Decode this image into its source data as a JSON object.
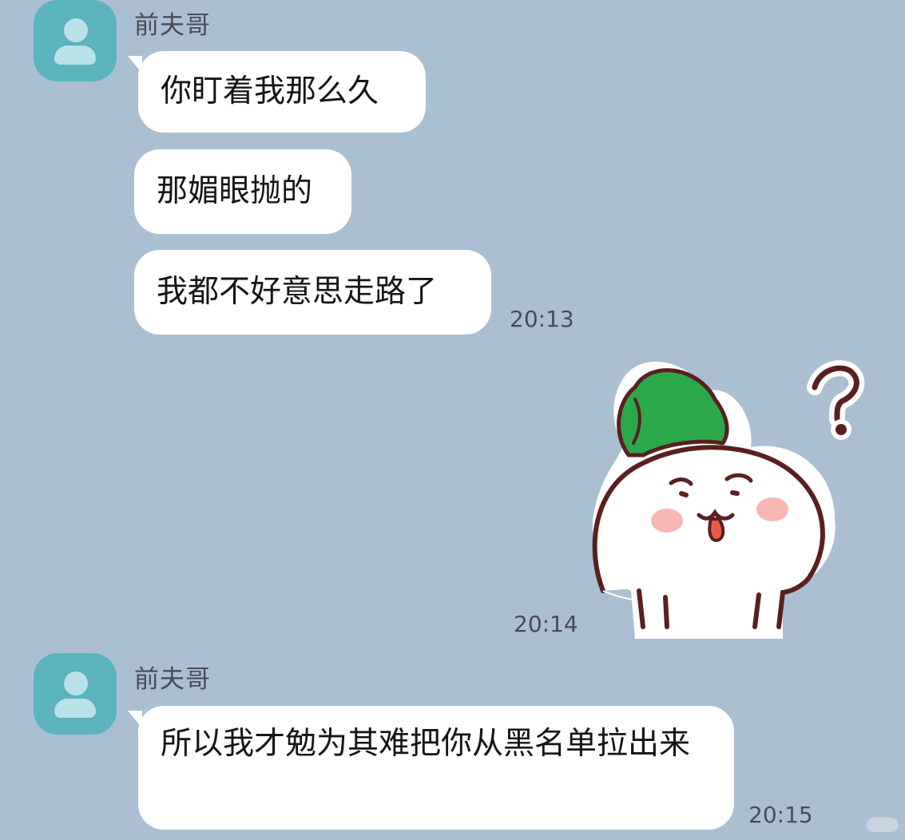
{
  "chat": {
    "messages": [
      {
        "sender": "前夫哥",
        "bubbles": [
          "你盯着我那么久",
          "那媚眼抛的",
          "我都不好意思走路了"
        ],
        "time": "20:13"
      },
      {
        "type": "sticker",
        "sticker_icon": "radish-question-sticker",
        "time": "20:14"
      },
      {
        "sender": "前夫哥",
        "bubbles": [
          "所以我才勉为其难把你从黑名单拉出来"
        ],
        "time": "20:15"
      }
    ]
  },
  "colors": {
    "background": "#abbfd2",
    "avatar": "#5bb3bc",
    "bubble": "#ffffff"
  }
}
